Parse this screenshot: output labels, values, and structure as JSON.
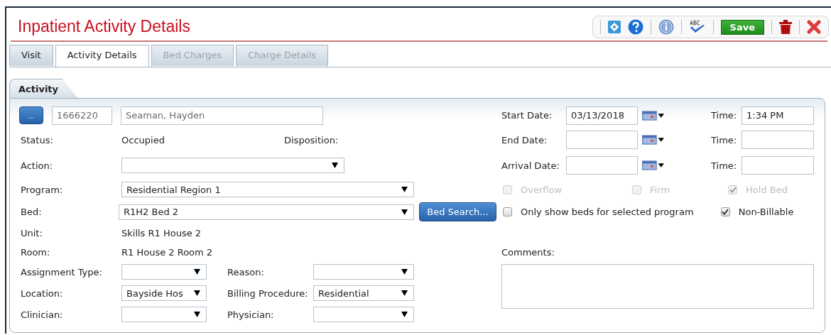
{
  "window": {
    "title": "Inpatient Activity Details"
  },
  "toolbar": [
    {
      "kind": "settings"
    },
    {
      "kind": "help"
    },
    {
      "kind": "info"
    },
    {
      "kind": "spellcheck"
    },
    {
      "kind": "save",
      "label": "Save"
    },
    {
      "kind": "delete"
    },
    {
      "kind": "close"
    }
  ],
  "tabs": [
    {
      "label": "Visit",
      "selected": false,
      "disabled": false
    },
    {
      "label": "Activity Details",
      "selected": true,
      "disabled": false
    },
    {
      "label": "Bed Charges",
      "selected": false,
      "disabled": true
    },
    {
      "label": "Charge Details",
      "selected": false,
      "disabled": true
    }
  ],
  "section": {
    "title": "Activity"
  },
  "patient": {
    "lookup_button": "...",
    "id": "1666220",
    "name": "Seaman, Hayden"
  },
  "status": {
    "label": "Status:",
    "value": "Occupied",
    "disposition_label": "Disposition:"
  },
  "action": {
    "label": "Action:"
  },
  "program": {
    "label": "Program:",
    "value": "Residential Region 1"
  },
  "bed": {
    "label": "Bed:",
    "value": "R1H2 Bed 2",
    "search_button": "Bed Search..."
  },
  "unit": {
    "label": "Unit:",
    "value": "Skills R1 House 2"
  },
  "room": {
    "label": "Room:",
    "value": "R1 House 2 Room 2"
  },
  "pairs": [
    {
      "label": "Assignment Type:",
      "label_2": "Reason:"
    },
    {
      "label": "Location:",
      "value": "Bayside Hos",
      "label_2": "Billing Procedure:",
      "value_2": "Residential"
    },
    {
      "label": "Clinician:",
      "label_2": "Physician:"
    }
  ],
  "dates": [
    {
      "label": "Start Date:",
      "value": "03/13/2018",
      "time_label": "Time:",
      "time_value": "1:34 PM"
    },
    {
      "label": "End Date:",
      "time_label": "Time:"
    },
    {
      "label": "Arrival Date:",
      "time_label": "Time:"
    }
  ],
  "checkbox_rows": [
    [
      {
        "label": "Overflow",
        "checked": false,
        "disabled": true
      },
      {
        "label": "Firm",
        "checked": false,
        "disabled": true
      },
      {
        "label": "Hold Bed",
        "checked": true,
        "disabled": true
      }
    ],
    [
      {
        "label": "Only show beds for selected program",
        "checked": false,
        "disabled": false
      },
      {
        "label": "Non-Billable",
        "checked": true,
        "disabled": false
      }
    ]
  ],
  "comments": {
    "label": "Comments:"
  }
}
